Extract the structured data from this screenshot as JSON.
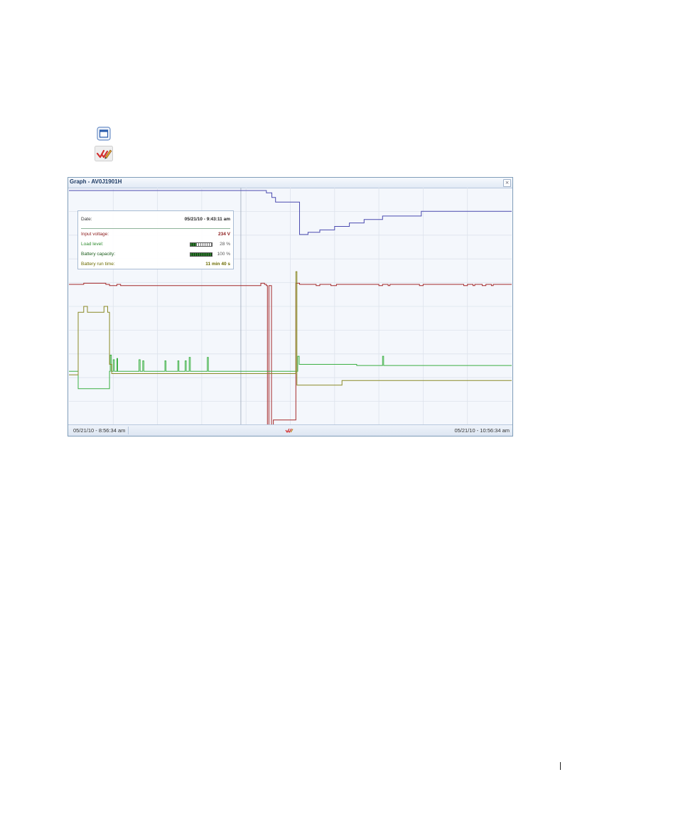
{
  "window": {
    "title": "Graph - AV0J1901H",
    "close_glyph": "×"
  },
  "icons": {
    "window": "window-icon",
    "graph_check": "check-pencil-icon",
    "close": "close-icon"
  },
  "status_bar": {
    "start_time": "05/21/10 - 8:56:34 am",
    "end_time": "05/21/10 - 10:56:34 am"
  },
  "tooltip": {
    "date_label": "Date:",
    "date_value": "05/21/10 - 9:43:11 am",
    "rows": [
      {
        "label": "Input voltage:",
        "value": "234 V",
        "color": "#8b1a1a"
      },
      {
        "label": "Load level:",
        "pct": "28 %",
        "level": 0.28,
        "color": "#2e8b2e"
      },
      {
        "label": "Battery capacity:",
        "pct": "100 %",
        "level": 1.0,
        "color": "#1a5c1a"
      },
      {
        "label": "Battery run time:",
        "value": "11 min 40 s",
        "color": "#6b6b00"
      }
    ]
  },
  "chart_data": {
    "type": "line",
    "x_start": "05/21/10 - 8:56:34 am",
    "x_end": "05/21/10 - 10:56:34 am",
    "x_minutes_range": [
      0,
      120
    ],
    "y_range": [
      0,
      100
    ],
    "grid": true,
    "cursor_minute": 46.6,
    "colors": {
      "input_voltage": "#a52a2a",
      "load_level": "#3cb043",
      "battery_capacity": "#4b4bb0",
      "battery_run_time": "#8a8a26"
    },
    "series": [
      {
        "key": "battery_capacity",
        "points": [
          [
            0,
            100
          ],
          [
            53.5,
            100
          ],
          [
            53.5,
            99
          ],
          [
            55,
            99
          ],
          [
            55,
            97
          ],
          [
            56,
            97
          ],
          [
            56,
            95
          ],
          [
            62.5,
            95
          ],
          [
            62.5,
            81
          ],
          [
            64.8,
            81
          ],
          [
            64.8,
            82
          ],
          [
            68,
            82
          ],
          [
            68,
            83
          ],
          [
            72,
            83
          ],
          [
            72,
            84.5
          ],
          [
            76,
            84.5
          ],
          [
            76,
            86
          ],
          [
            80,
            86
          ],
          [
            80,
            87.5
          ],
          [
            85,
            87.5
          ],
          [
            85,
            89
          ],
          [
            95.5,
            89
          ],
          [
            95.5,
            91
          ],
          [
            120,
            91
          ]
        ]
      },
      {
        "key": "input_voltage",
        "points": [
          [
            0,
            59.5
          ],
          [
            4,
            59.5
          ],
          [
            4,
            60
          ],
          [
            10,
            60
          ],
          [
            10,
            59.5
          ],
          [
            11,
            59.5
          ],
          [
            11,
            59
          ],
          [
            13,
            59
          ],
          [
            13,
            59.5
          ],
          [
            14,
            59.5
          ],
          [
            14,
            59
          ],
          [
            52,
            59
          ],
          [
            52,
            60
          ],
          [
            53,
            60
          ],
          [
            53,
            59.5
          ],
          [
            53.5,
            59.5
          ],
          [
            53.5,
            59
          ],
          [
            53.8,
            59
          ],
          [
            53.8,
            -2
          ],
          [
            54.2,
            -2
          ],
          [
            54.2,
            59
          ],
          [
            54.9,
            59
          ],
          [
            54.9,
            -2
          ],
          [
            55.4,
            -2
          ],
          [
            55.4,
            1
          ],
          [
            61.5,
            1
          ],
          [
            61.5,
            60
          ],
          [
            62.5,
            60
          ],
          [
            62.5,
            59.5
          ],
          [
            67,
            59.5
          ],
          [
            67,
            59
          ],
          [
            68,
            59
          ],
          [
            68,
            59.5
          ],
          [
            71,
            59.5
          ],
          [
            71,
            59
          ],
          [
            72.5,
            59
          ],
          [
            72.5,
            59.5
          ],
          [
            84,
            59.5
          ],
          [
            84,
            59
          ],
          [
            85,
            59
          ],
          [
            85,
            59.5
          ],
          [
            86.5,
            59.5
          ],
          [
            86.5,
            59
          ],
          [
            87,
            59
          ],
          [
            87,
            59.5
          ],
          [
            95,
            59.5
          ],
          [
            95,
            59
          ],
          [
            96,
            59
          ],
          [
            96,
            59.5
          ],
          [
            107,
            59.5
          ],
          [
            107,
            59
          ],
          [
            108,
            59
          ],
          [
            108,
            59.5
          ],
          [
            109.5,
            59.5
          ],
          [
            109.5,
            59
          ],
          [
            110,
            59
          ],
          [
            110,
            59.5
          ],
          [
            112,
            59.5
          ],
          [
            112,
            59
          ],
          [
            113,
            59
          ],
          [
            113,
            59.5
          ],
          [
            114.5,
            59.5
          ],
          [
            114.5,
            59
          ],
          [
            115,
            59
          ],
          [
            115,
            59.5
          ],
          [
            120,
            59.5
          ]
        ]
      },
      {
        "key": "load_level",
        "points": [
          [
            0,
            22
          ],
          [
            2.5,
            22
          ],
          [
            2.5,
            14.5
          ],
          [
            11,
            14.5
          ],
          [
            11,
            22
          ],
          [
            11.2,
            22
          ],
          [
            11.2,
            29
          ],
          [
            11.5,
            29
          ],
          [
            11.5,
            22
          ],
          [
            12,
            22
          ],
          [
            12,
            27
          ],
          [
            12.3,
            27
          ],
          [
            12.3,
            22
          ],
          [
            13,
            22
          ],
          [
            13,
            27.5
          ],
          [
            13.2,
            27.5
          ],
          [
            13.2,
            22
          ],
          [
            19,
            22
          ],
          [
            19,
            27
          ],
          [
            19.3,
            27
          ],
          [
            19.3,
            22
          ],
          [
            20,
            22
          ],
          [
            20,
            26.5
          ],
          [
            20.3,
            26.5
          ],
          [
            20.3,
            22
          ],
          [
            26,
            22
          ],
          [
            26,
            26.5
          ],
          [
            26.3,
            26.5
          ],
          [
            26.3,
            22
          ],
          [
            29.5,
            22
          ],
          [
            29.5,
            26.5
          ],
          [
            29.8,
            26.5
          ],
          [
            29.8,
            22
          ],
          [
            31.5,
            22
          ],
          [
            31.5,
            26.5
          ],
          [
            31.8,
            26.5
          ],
          [
            31.8,
            22
          ],
          [
            32.6,
            22
          ],
          [
            32.6,
            28
          ],
          [
            32.9,
            28
          ],
          [
            32.9,
            22
          ],
          [
            37.5,
            22
          ],
          [
            37.5,
            28
          ],
          [
            37.8,
            28
          ],
          [
            37.8,
            22
          ],
          [
            62,
            22
          ],
          [
            62,
            28.5
          ],
          [
            62.4,
            28.5
          ],
          [
            62.4,
            25
          ],
          [
            78,
            25
          ],
          [
            78,
            24.5
          ],
          [
            85,
            24.5
          ],
          [
            85,
            28.5
          ],
          [
            85.3,
            28.5
          ],
          [
            85.3,
            24.5
          ],
          [
            120,
            24.5
          ]
        ]
      },
      {
        "key": "battery_run_time",
        "points": [
          [
            0,
            20.5
          ],
          [
            2.5,
            20.5
          ],
          [
            2.5,
            47.5
          ],
          [
            4,
            47.5
          ],
          [
            4,
            50
          ],
          [
            5,
            50
          ],
          [
            5,
            47.5
          ],
          [
            9.5,
            47.5
          ],
          [
            9.5,
            50
          ],
          [
            10.5,
            50
          ],
          [
            10.5,
            47.5
          ],
          [
            11,
            47.5
          ],
          [
            11,
            25
          ],
          [
            11.6,
            25
          ],
          [
            11.6,
            21
          ],
          [
            61.5,
            21
          ],
          [
            61.5,
            65
          ],
          [
            61.8,
            65
          ],
          [
            61.8,
            16
          ],
          [
            74,
            16
          ],
          [
            74,
            18
          ],
          [
            120,
            18
          ]
        ]
      }
    ]
  }
}
